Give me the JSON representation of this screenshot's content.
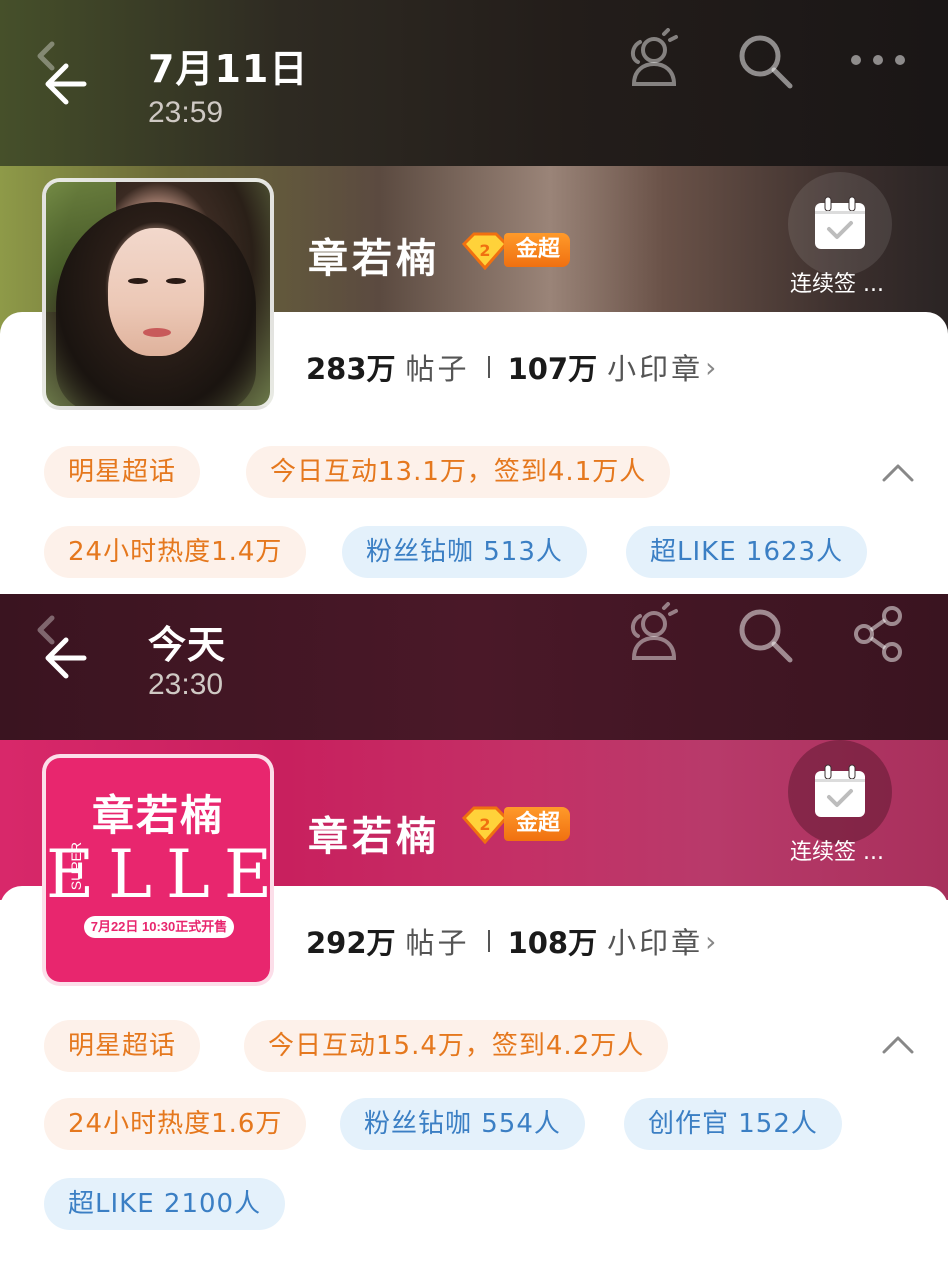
{
  "panels": [
    {
      "header": {
        "date": "7月11日",
        "time": "23:59"
      },
      "topbar_icons": [
        "group-icon",
        "search-icon",
        "more-icon"
      ],
      "profile": {
        "name": "章若楠",
        "badge_label": "金超",
        "checkin_label": "连续签 ...",
        "posts_count": "283万",
        "posts_label": "帖子",
        "stamps_count": "107万",
        "stamps_label": "小印章",
        "stamps_arrow": "›"
      },
      "tags_row1": [
        "明星超话",
        "今日互动13.1万，签到4.1万人"
      ],
      "tags_row2": [
        {
          "text": "24小时热度1.4万",
          "color": "orange"
        },
        {
          "text": "粉丝钻咖 513人",
          "color": "blue"
        },
        {
          "text": "超LIKE 1623人",
          "color": "blue"
        }
      ]
    },
    {
      "header": {
        "date": "今天",
        "time": "23:30"
      },
      "topbar_icons": [
        "group-icon",
        "search-icon",
        "share-icon"
      ],
      "profile": {
        "name": "章若楠",
        "badge_label": "金超",
        "checkin_label": "连续签 ...",
        "posts_count": "292万",
        "posts_label": "帖子",
        "stamps_count": "108万",
        "stamps_label": "小印章",
        "stamps_arrow": "›",
        "avatar_poster": {
          "title": "章若楠",
          "brand": "ELLE",
          "super": "SUPER",
          "band": "7月22日 10:30正式开售"
        }
      },
      "tags_row1": [
        "明星超话",
        "今日互动15.4万，签到4.2万人"
      ],
      "tags_row2": [
        {
          "text": "24小时热度1.6万",
          "color": "orange"
        },
        {
          "text": "粉丝钻咖 554人",
          "color": "blue"
        },
        {
          "text": "创作官 152人",
          "color": "blue"
        }
      ],
      "tags_row3": [
        {
          "text": "超LIKE 2100人",
          "color": "blue"
        }
      ]
    }
  ],
  "colors": {
    "chip_orange_text": "#e5781e",
    "chip_orange_bg": "#fdf1ea",
    "chip_blue_text": "#3b7fc4",
    "chip_blue_bg": "#e4f1fb",
    "badge": "#f07010",
    "panel2_accent": "#d8286a"
  }
}
